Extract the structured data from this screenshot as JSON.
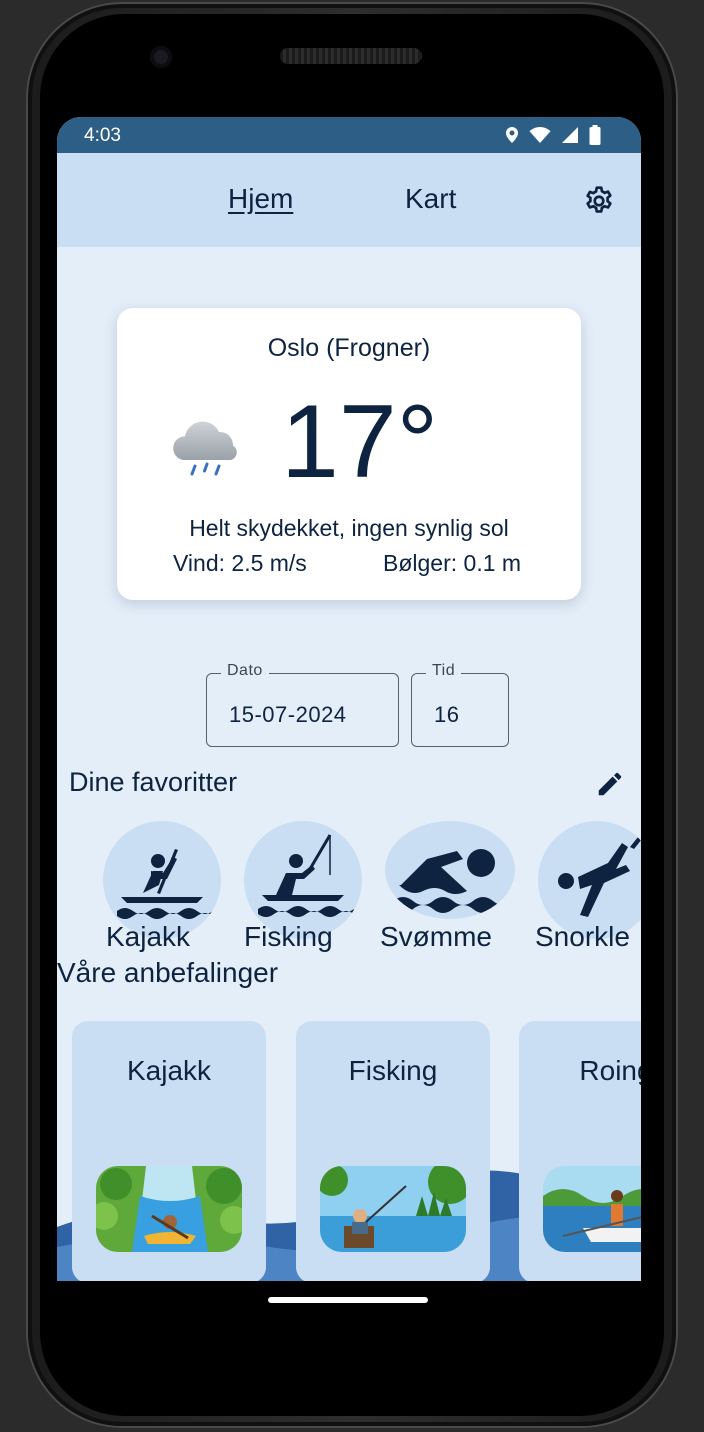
{
  "status_bar": {
    "time": "4:03"
  },
  "nav": {
    "home": "Hjem",
    "map": "Kart"
  },
  "weather": {
    "location": "Oslo (Frogner)",
    "temperature": "17°",
    "description": "Helt skydekket, ingen synlig sol",
    "wind": "Vind: 2.5 m/s",
    "waves": "Bølger: 0.1 m",
    "icon": "cloud-rain-icon"
  },
  "date_field": {
    "label": "Dato",
    "value": "15-07-2024"
  },
  "time_field": {
    "label": "Tid",
    "value": "16"
  },
  "favorites": {
    "title": "Dine favoritter",
    "items": [
      {
        "label": "Kajakk",
        "icon": "kayak-icon"
      },
      {
        "label": "Fisking",
        "icon": "fishing-icon"
      },
      {
        "label": "Svømme",
        "icon": "swimming-icon"
      },
      {
        "label": "Snorkle",
        "icon": "snorkel-icon"
      }
    ]
  },
  "recommendations": {
    "title": "Våre anbefalinger",
    "items": [
      {
        "label": "Kajakk"
      },
      {
        "label": "Fisking"
      },
      {
        "label": "Roing"
      }
    ]
  },
  "colors": {
    "status_bar": "#2d5f86",
    "nav_bg": "#c9def2",
    "screen_bg": "#e4eef9",
    "text": "#0d2340"
  }
}
